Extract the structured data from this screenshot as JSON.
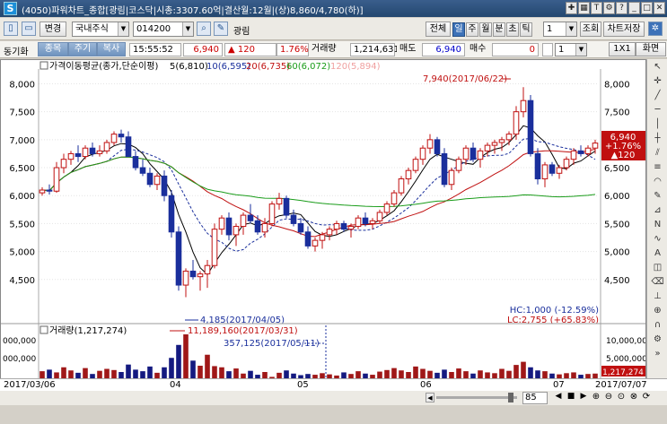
{
  "window": {
    "title": "(4050)파워차트_종합[광림|코스닥|시총:3307.60억|결산월:12월|(상)8,860/4,780(하)]"
  },
  "toolbar": {
    "change_label": "변경",
    "market_select": "국내주식",
    "code_select": "014200",
    "stock_name": "광림",
    "all_label": "전체",
    "period_tabs": [
      "일",
      "주",
      "월",
      "분",
      "초",
      "틱"
    ],
    "active_period": "일",
    "period_count": "1",
    "lookup_label": "조회",
    "save_label": "차트저장"
  },
  "subbar": {
    "sync_label": "동기화",
    "btn_stock": "종목",
    "btn_cycle": "주기",
    "btn_copy": "복사",
    "time": "15:55:52",
    "price": "6,940",
    "change_arrow": "▲",
    "change": "120",
    "change_pct": "1.76%",
    "volume_label": "거래량",
    "volume": "1,214,631",
    "ask_label": "매도",
    "ask": "6,940",
    "bid_label": "매수",
    "bid": "0",
    "chart_count": "1",
    "tab_1x1": "1X1",
    "tab_screen": "화면"
  },
  "chart": {
    "price_legend": "가격이동평균(종가,단순이평)",
    "ma": [
      {
        "name": "5(6,810)",
        "color": "#000000"
      },
      {
        "name": "10(6,595)",
        "color": "#1a2f9c"
      },
      {
        "name": "20(6,735)",
        "color": "#c01010"
      },
      {
        "name": "60(6,072)",
        "color": "#1a9c1a"
      },
      {
        "name": "120(5,894)",
        "color": "#f0a0a0"
      }
    ],
    "high_annotation": "7,940(2017/06/22)",
    "low_annotation": "4,185(2017/04/05)",
    "hc_text": "HC:1,000 (-12.59%)",
    "lc_text": "LC:2,755 (+65.83%)",
    "price_axis": [
      "8,000",
      "7,500",
      "7,000",
      "6,500",
      "6,000",
      "5,500",
      "5,000",
      "4,500"
    ],
    "current_price_tag": [
      "6,940",
      "+1.76%",
      "▲120"
    ],
    "volume_legend": "거래량(1,217,274)",
    "vol_max_annotation": "11,189,160(2017/03/31)",
    "vol_annotation2": "357,125(2017/05/11)",
    "vol_axis_left": [
      "000,000",
      "000,000"
    ],
    "vol_axis_right": [
      "10,000,000",
      "5,000,000"
    ],
    "vol_current_tag": "1,217,274",
    "x_labels": [
      "2017/03/06",
      "04",
      "05",
      "06",
      "07",
      "2017/07/07"
    ],
    "zoom_value": "85"
  },
  "chart_data": {
    "type": "candlestick",
    "title": "",
    "ylim": [
      4000,
      8200
    ],
    "candles": [
      [
        6050,
        6150,
        6000,
        6100
      ],
      [
        6100,
        6200,
        6020,
        6080
      ],
      [
        6080,
        6600,
        6050,
        6500
      ],
      [
        6500,
        6750,
        6400,
        6650
      ],
      [
        6650,
        6800,
        6550,
        6750
      ],
      [
        6750,
        6900,
        6600,
        6700
      ],
      [
        6700,
        6900,
        6650,
        6850
      ],
      [
        6850,
        6950,
        6700,
        6750
      ],
      [
        6750,
        6900,
        6700,
        6800
      ],
      [
        6800,
        7000,
        6750,
        6950
      ],
      [
        6950,
        7150,
        6900,
        7100
      ],
      [
        7100,
        7180,
        6950,
        7050
      ],
      [
        7050,
        7150,
        6900,
        6700
      ],
      [
        6700,
        6800,
        6450,
        6500
      ],
      [
        6500,
        6650,
        6350,
        6400
      ],
      [
        6400,
        6500,
        6150,
        6200
      ],
      [
        6200,
        6400,
        6100,
        6350
      ],
      [
        6350,
        6450,
        5900,
        6000
      ],
      [
        6000,
        6100,
        5250,
        5350
      ],
      [
        5350,
        5450,
        4300,
        4400
      ],
      [
        4400,
        4700,
        4185,
        4650
      ],
      [
        4650,
        4850,
        4500,
        4550
      ],
      [
        4550,
        4650,
        4300,
        4600
      ],
      [
        4600,
        4850,
        4350,
        4750
      ],
      [
        4750,
        5500,
        4700,
        5400
      ],
      [
        5400,
        5650,
        5300,
        5600
      ],
      [
        5600,
        5700,
        5200,
        5300
      ],
      [
        5300,
        5500,
        5100,
        5450
      ],
      [
        5450,
        5700,
        5300,
        5650
      ],
      [
        5650,
        5850,
        5500,
        5550
      ],
      [
        5550,
        5650,
        5300,
        5350
      ],
      [
        5350,
        5600,
        5250,
        5500
      ],
      [
        5500,
        5900,
        5450,
        5850
      ],
      [
        5850,
        6050,
        5750,
        5950
      ],
      [
        5950,
        6000,
        5600,
        5650
      ],
      [
        5650,
        5750,
        5450,
        5500
      ],
      [
        5500,
        5600,
        5300,
        5350
      ],
      [
        5350,
        5450,
        5050,
        5100
      ],
      [
        5100,
        5250,
        5000,
        5200
      ],
      [
        5200,
        5350,
        5050,
        5300
      ],
      [
        5300,
        5450,
        5200,
        5400
      ],
      [
        5400,
        5550,
        5300,
        5500
      ],
      [
        5500,
        5550,
        5350,
        5400
      ],
      [
        5400,
        5500,
        5250,
        5450
      ],
      [
        5450,
        5650,
        5400,
        5600
      ],
      [
        5600,
        5700,
        5450,
        5500
      ],
      [
        5500,
        5600,
        5400,
        5550
      ],
      [
        5550,
        5750,
        5500,
        5700
      ],
      [
        5700,
        5900,
        5650,
        5850
      ],
      [
        5850,
        6100,
        5800,
        6050
      ],
      [
        6050,
        6350,
        6000,
        6300
      ],
      [
        6300,
        6500,
        6200,
        6450
      ],
      [
        6450,
        6700,
        6400,
        6650
      ],
      [
        6650,
        6900,
        6550,
        6850
      ],
      [
        6850,
        7100,
        6750,
        7000
      ],
      [
        7000,
        7050,
        6700,
        6750
      ],
      [
        6750,
        6850,
        6150,
        6200
      ],
      [
        6200,
        6500,
        6100,
        6450
      ],
      [
        6450,
        6700,
        6400,
        6650
      ],
      [
        6650,
        6900,
        6550,
        6850
      ],
      [
        6850,
        6950,
        6600,
        6650
      ],
      [
        6650,
        6850,
        6500,
        6800
      ],
      [
        6800,
        6950,
        6700,
        6900
      ],
      [
        6900,
        7000,
        6750,
        6950
      ],
      [
        6950,
        7050,
        6800,
        7000
      ],
      [
        7000,
        7150,
        6900,
        7100
      ],
      [
        7100,
        7600,
        7000,
        7500
      ],
      [
        7500,
        7940,
        7400,
        7700
      ],
      [
        7700,
        7800,
        6700,
        6750
      ],
      [
        6750,
        6850,
        6200,
        6300
      ],
      [
        6300,
        6600,
        6150,
        6550
      ],
      [
        6550,
        6600,
        6350,
        6400
      ],
      [
        6400,
        6550,
        6300,
        6500
      ],
      [
        6500,
        6700,
        6450,
        6650
      ],
      [
        6650,
        6850,
        6550,
        6800
      ],
      [
        6800,
        6900,
        6700,
        6750
      ],
      [
        6750,
        6900,
        6700,
        6850
      ],
      [
        6850,
        7000,
        6750,
        6940
      ]
    ],
    "volumes": [
      1.8,
      2.2,
      1.5,
      2.8,
      2.0,
      1.4,
      2.6,
      1.1,
      1.9,
      2.4,
      2.1,
      1.6,
      3.5,
      2.2,
      1.8,
      3.0,
      1.4,
      2.8,
      5.2,
      8.5,
      11.19,
      4.5,
      3.2,
      6.0,
      3.1,
      2.8,
      1.8,
      2.5,
      1.2,
      1.9,
      0.9,
      1.6,
      0.36,
      1.4,
      2.0,
      1.2,
      0.8,
      1.1,
      0.9,
      1.3,
      1.0,
      0.7,
      1.5,
      1.1,
      1.8,
      1.2,
      0.9,
      1.7,
      2.1,
      2.6,
      2.0,
      1.6,
      3.0,
      2.4,
      1.9,
      1.4,
      2.2,
      1.6,
      2.5,
      1.8,
      1.2,
      2.0,
      1.5,
      1.3,
      2.4,
      1.9,
      3.4,
      4.2,
      2.8,
      2.0,
      1.8,
      1.2,
      1.0,
      1.3,
      1.5,
      0.9,
      1.1,
      1.2
    ],
    "volume_unit": "millions"
  }
}
